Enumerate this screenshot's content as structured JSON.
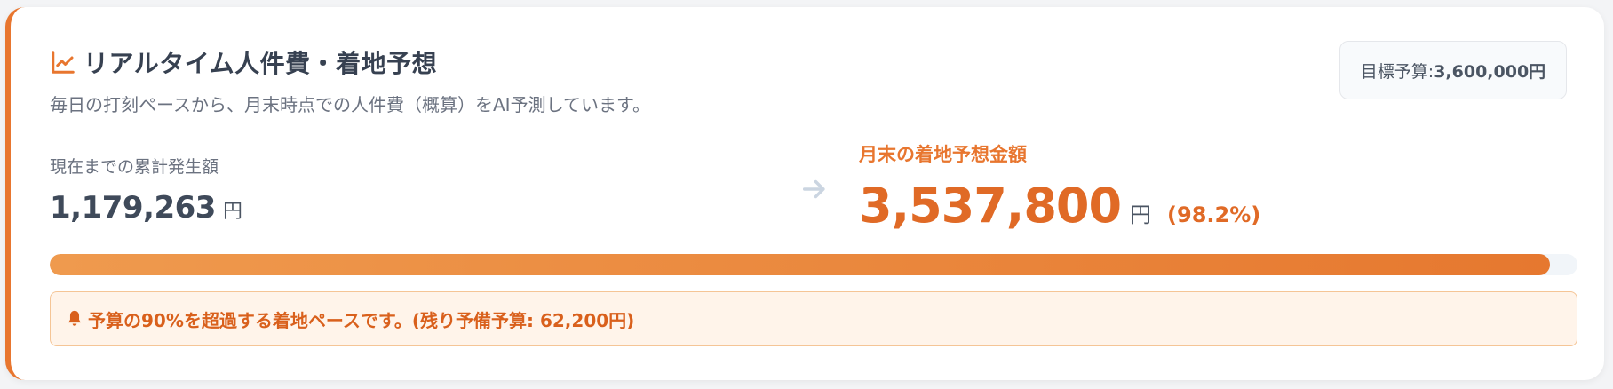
{
  "header": {
    "title": "リアルタイム人件費・着地予想",
    "subtitle": "毎日の打刻ペースから、月末時点での人件費（概算）をAI予測しています。"
  },
  "budget": {
    "label": "目標予算: ",
    "value": "3,600,000円"
  },
  "current": {
    "label": "現在までの累計発生額",
    "value": "1,179,263",
    "unit": "円"
  },
  "forecast": {
    "label": "月末の着地予想金額",
    "value": "3,537,800",
    "unit": "円",
    "percent": "(98.2%)"
  },
  "progress": {
    "fraction": 0.982
  },
  "alert": {
    "text": "予算の90%を超過する着地ペースです。(残り予備予算: 62,200円)"
  },
  "colors": {
    "accent": "#e8762f",
    "accent_dark": "#e06a26",
    "alert_bg": "#fff4ea"
  },
  "icons": {
    "title": "trend-chart-icon",
    "arrow": "arrow-right-icon",
    "alert": "bell-icon"
  }
}
